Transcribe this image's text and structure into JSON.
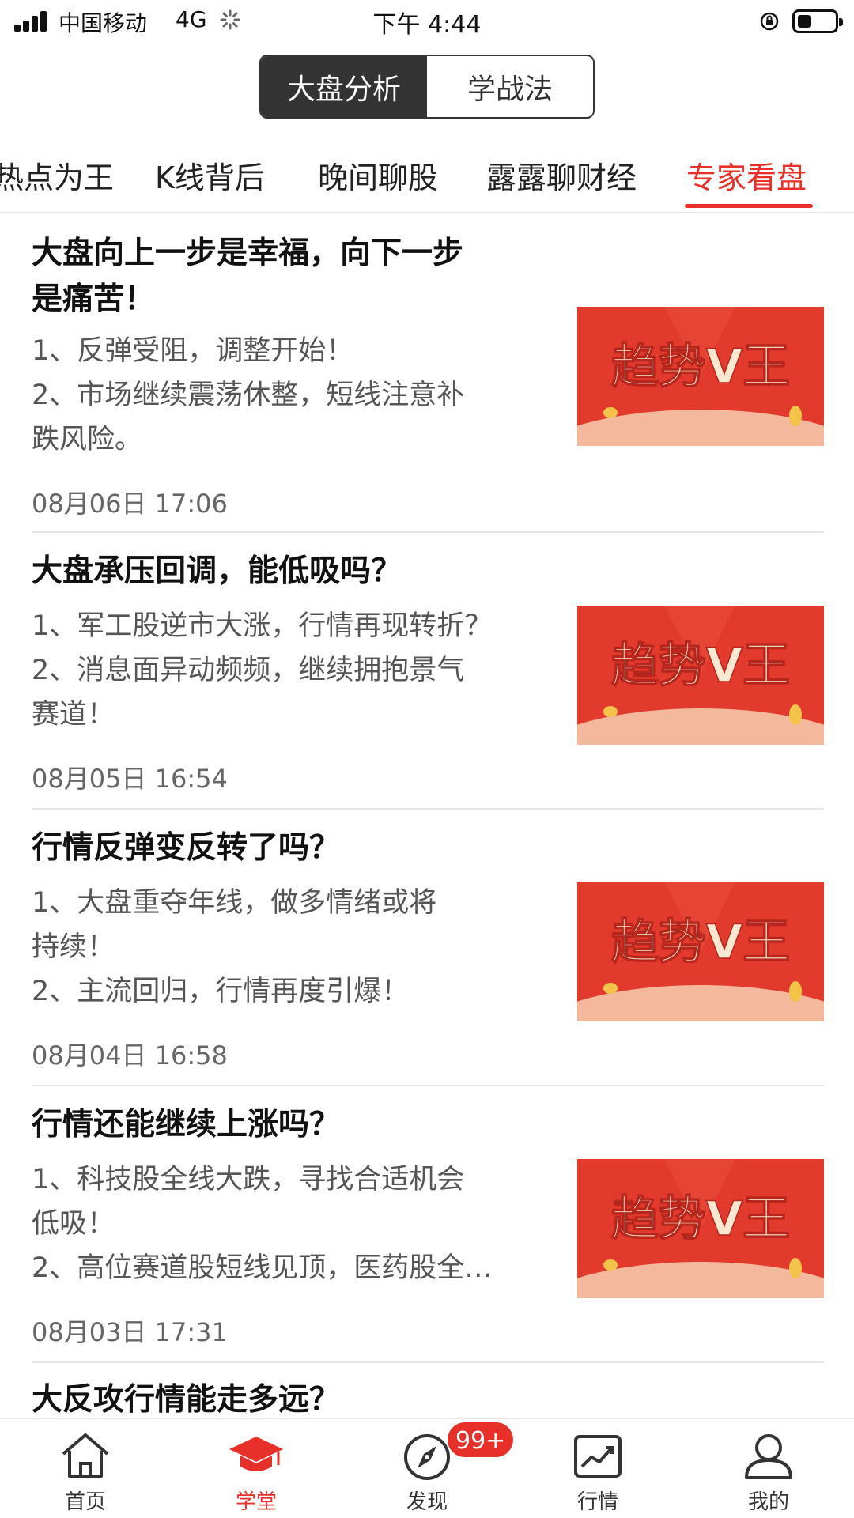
{
  "status_bar": {
    "carrier": "中国移动",
    "network": "4G",
    "time": "下午 4:44"
  },
  "segmented": {
    "items": [
      "大盘分析",
      "学战法"
    ],
    "active_index": 0
  },
  "category_tabs": {
    "items": [
      "热点为王",
      "K线背后",
      "晚间聊股",
      "露露聊财经",
      "专家看盘"
    ],
    "active_index": 4
  },
  "thumbnail": {
    "text": "趋势V王"
  },
  "articles": [
    {
      "title_lines": [
        "大盘向上一步是幸福，向下一步",
        "是痛苦！"
      ],
      "summary_lines": [
        "1、反弹受阻，调整开始！",
        "2、市场继续震荡休整，短线注意补",
        "跌风险。"
      ],
      "date": "08月06日 17:06"
    },
    {
      "title_lines": [
        "大盘承压回调，能低吸吗？"
      ],
      "summary_lines": [
        "1、军工股逆市大涨，行情再现转折？",
        "2、消息面异动频频，继续拥抱景气",
        "赛道！"
      ],
      "date": "08月05日 16:54"
    },
    {
      "title_lines": [
        "行情反弹变反转了吗？"
      ],
      "summary_lines": [
        "1、大盘重夺年线，做多情绪或将",
        "持续！",
        "2、主流回归，行情再度引爆！"
      ],
      "date": "08月04日 16:58"
    },
    {
      "title_lines": [
        "行情还能继续上涨吗？"
      ],
      "summary_lines": [
        "1、科技股全线大跌，寻找合适机会",
        "低吸！",
        "2、高位赛道股短线见顶，医药股全…"
      ],
      "date": "08月03日 17:31"
    },
    {
      "title_lines": [
        "大反攻行情能走多远？"
      ],
      "summary_lines": [],
      "date": ""
    }
  ],
  "bottom_nav": {
    "items": [
      {
        "label": "首页",
        "icon": "home-icon"
      },
      {
        "label": "学堂",
        "icon": "graduation-cap-icon"
      },
      {
        "label": "发现",
        "icon": "compass-icon",
        "badge": "99+"
      },
      {
        "label": "行情",
        "icon": "chart-trend-icon"
      },
      {
        "label": "我的",
        "icon": "user-icon"
      }
    ],
    "active_index": 1
  },
  "colors": {
    "accent": "#e8302a",
    "segment_active": "#333333"
  }
}
